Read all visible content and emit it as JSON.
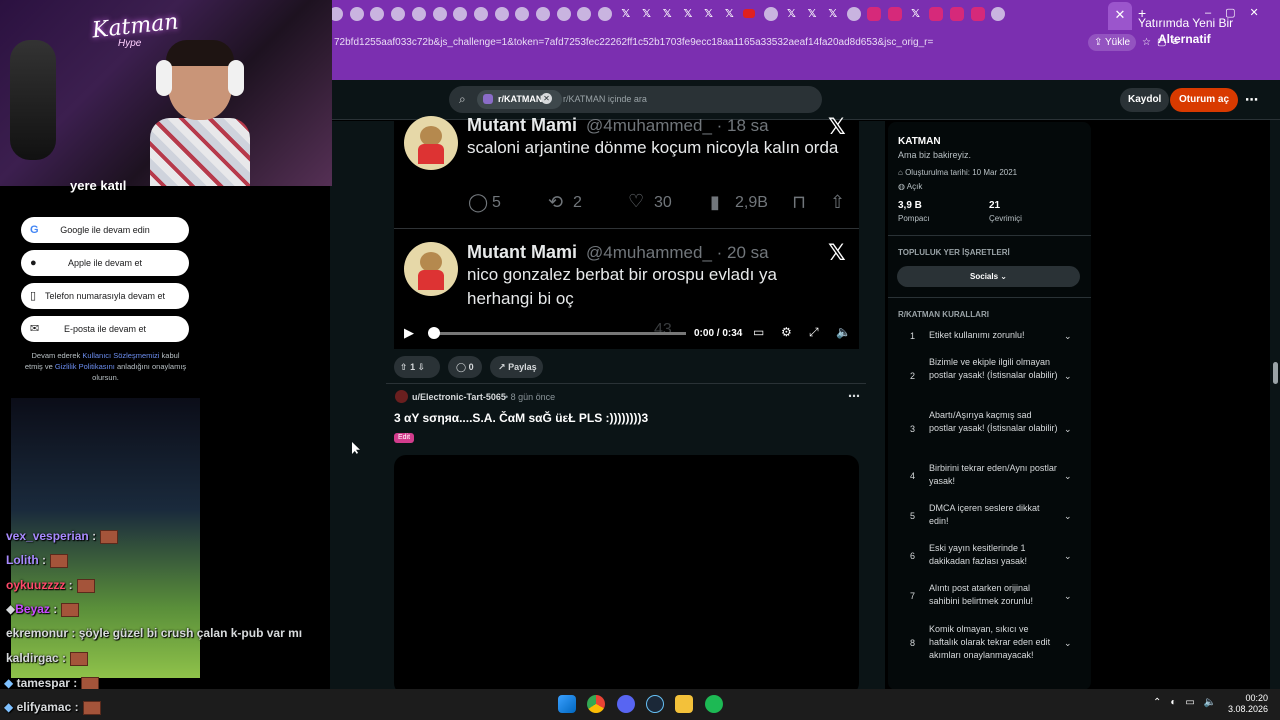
{
  "browser": {
    "active_tab_title": "Yatırımda Yeni Bir",
    "url": "72bfd1255aaf033c72b&js_challenge=1&token=7afd7253fec22262ff1c52b1703fe9ecc18aa1165a33532aeaf14fa20ad8d653&jsc_orig_r=",
    "upload_label": "Yükle",
    "alt_label": "Alternatif",
    "new_tab": "+",
    "active_tab_close": "✕"
  },
  "header": {
    "search_chip": "r/KATMAN",
    "search_placeholder": "r/KATMAN içinde ara",
    "signup": "Kaydol",
    "login": "Oturum aç"
  },
  "tweets": [
    {
      "name": "Mutant Mami",
      "handle": "@4muhammed_ · 18 sa",
      "text": "scaloni arjantine dönme koçum nicoyla kalın orda",
      "replies": "5",
      "retweets": "2",
      "likes": "30",
      "views": "2,9B"
    },
    {
      "name": "Mutant Mami",
      "handle": "@4muhammed_ · 20 sa",
      "text": "nico gonzalez berbat bir orospu evladı ya herhangi bi oç",
      "likes": "43"
    }
  ],
  "video": {
    "time": "0:00 / 0:34"
  },
  "post_actions": {
    "votes": "1",
    "comments": "0",
    "share": "Paylaş"
  },
  "post": {
    "user": "u/Electronic-Tart-5065",
    "age": "• 8 gün önce",
    "title": "3 αY ѕσηяα....S.A. ČαM ѕαĞ üεŁ PLS :))))))))3",
    "flair": "Edit"
  },
  "sidebar": {
    "name": "KATMAN",
    "tagline": "Ama biz bakireyiz.",
    "created": "Oluşturulma tarihi: 10 Mar 2021",
    "visibility": "Açık",
    "members_value": "3,9 B",
    "members_label": "Pompacı",
    "online_value": "21",
    "online_label": "Çevrimiçi",
    "bookmarks_heading": "TOPLULUK YER İŞARETLERİ",
    "socials": "Socials",
    "rules_heading": "R/KATMAN KURALLARI",
    "rules": [
      {
        "n": "1",
        "t": "Etiket kullanımı zorunlu!"
      },
      {
        "n": "2",
        "t": "Bizimle ve ekiple ilgili olmayan postlar yasak! (İstisnalar olabilir)"
      },
      {
        "n": "3",
        "t": "Abartı/Aşırıya kaçmış sad postlar yasak! (İstisnalar olabilir)"
      },
      {
        "n": "4",
        "t": "Birbirini tekrar eden/Aynı postlar yasak!"
      },
      {
        "n": "5",
        "t": "DMCA içeren seslere dikkat edin!"
      },
      {
        "n": "6",
        "t": "Eski yayın kesitlerinde 1 dakikadan fazlası yasak!"
      },
      {
        "n": "7",
        "t": "Alıntı post atarken orijinal sahibini belirtmek zorunlu!"
      },
      {
        "n": "8",
        "t": "Komik olmayan, sıkıcı ve haftalık olarak tekrar eden edit akımları onaylanmayacak!"
      }
    ]
  },
  "stream": {
    "brand": "Katman",
    "hype": "Hype",
    "login_heading": "yere katıl",
    "login_google": "Google ile devam edin",
    "login_apple": "Apple ile devam et",
    "login_phone": "Telefon numarasıyla devam et",
    "login_email": "E-posta ile devam et",
    "terms_a": "Devam ederek ",
    "terms_link1": "Kullanıcı Sözleşmemizi",
    "terms_b": " kabul etmiş ve ",
    "terms_link2": "Gizlilik Politikasını",
    "terms_c": " anladığını onaylamış olursun.",
    "chat": [
      {
        "user": "vex_vesperian",
        "msg": " :",
        "color": "#a88bff"
      },
      {
        "user": "Lolith",
        "msg": " :",
        "color": "#a88bff"
      },
      {
        "user": "oykuuzzzz",
        "msg": " :",
        "color": "#ff4a6a"
      },
      {
        "user": "Beyaz",
        "msg": " :",
        "color": "#c84cff"
      },
      {
        "user": "ekremonur",
        "msg": " : şöyle güzel bi crush çalan k-pub var mı",
        "color": "#ffffff"
      },
      {
        "user": "kaldirgac",
        "msg": " :",
        "color": "#ffffff"
      },
      {
        "user": "tamespar",
        "msg": " :",
        "color": "#ffffff"
      },
      {
        "user": "elifyamac",
        "msg": " :",
        "color": "#ffffff"
      }
    ]
  },
  "taskbar": {
    "time": "00:20",
    "date": "3.08.2026"
  }
}
